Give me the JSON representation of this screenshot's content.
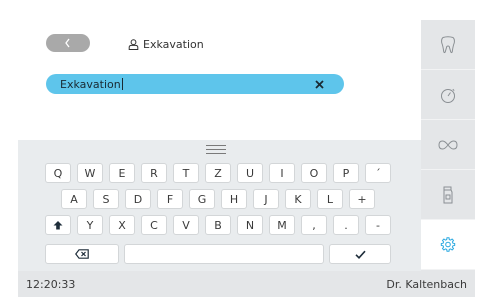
{
  "header": {
    "back_icon": "chevron-left-icon",
    "title": "Exkavation",
    "title_icon": "person-icon"
  },
  "search": {
    "value": "Exkavation",
    "clear_icon": "close-icon"
  },
  "keyboard": {
    "row1": [
      "Q",
      "W",
      "E",
      "R",
      "T",
      "Z",
      "U",
      "I",
      "O",
      "P",
      "´"
    ],
    "row2": [
      "A",
      "S",
      "D",
      "F",
      "G",
      "H",
      "J",
      "K",
      "L",
      "+"
    ],
    "row3": [
      "Y",
      "X",
      "C",
      "V",
      "B",
      "N",
      "M",
      ",",
      ".",
      "-"
    ],
    "shift_icon": "shift-arrow-icon",
    "backspace_icon": "backspace-icon",
    "confirm_icon": "checkmark-icon"
  },
  "sidebar": {
    "items": [
      {
        "icon": "tooth-icon"
      },
      {
        "icon": "stopwatch-icon"
      },
      {
        "icon": "infinity-icon"
      },
      {
        "icon": "bottle-icon"
      },
      {
        "icon": "gear-icon",
        "active": true
      }
    ],
    "accent": "#29a8e0"
  },
  "status": {
    "time": "12:20:33",
    "user": "Dr. Kaltenbach"
  },
  "colors": {
    "search_bg": "#5ec5eb",
    "keyboard_bg": "#e9ecee",
    "sidebar_bg": "#e4e6e8"
  }
}
